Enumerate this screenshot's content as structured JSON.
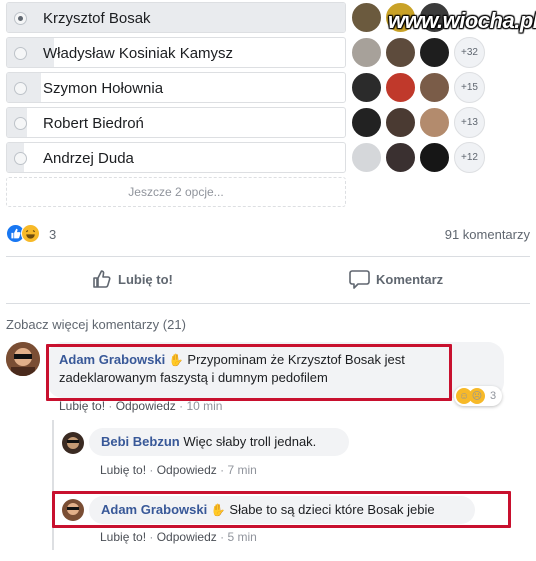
{
  "watermark": "www.wiocha.pl",
  "poll": {
    "options": [
      {
        "label": "Krzysztof Bosak",
        "selected": true,
        "fill_fraction": 1.0,
        "voters": [
          "avatar-a",
          "avatar-b",
          "avatar-c"
        ],
        "more": ""
      },
      {
        "label": "Władysław Kosiniak Kamysz",
        "selected": false,
        "fill_fraction": 0.14,
        "voters": [
          "avatar-d",
          "avatar-e",
          "avatar-f"
        ],
        "more": "+32"
      },
      {
        "label": "Szymon Hołownia",
        "selected": false,
        "fill_fraction": 0.1,
        "voters": [
          "avatar-g",
          "avatar-h",
          "avatar-i"
        ],
        "more": "+15"
      },
      {
        "label": "Robert Biedroń",
        "selected": false,
        "fill_fraction": 0.06,
        "voters": [
          "avatar-j",
          "avatar-k",
          "avatar-l"
        ],
        "more": "+13"
      },
      {
        "label": "Andrzej Duda",
        "selected": false,
        "fill_fraction": 0.05,
        "voters": [
          "avatar-m",
          "avatar-n",
          "avatar-o"
        ],
        "more": "+12"
      }
    ],
    "more_options": "Jeszcze 2 opcje..."
  },
  "reactions": {
    "count": "3",
    "icons": [
      "like-icon",
      "haha-icon"
    ],
    "comments_count": "91 komentarzy"
  },
  "actions": {
    "like": "Lubię to!",
    "comment": "Komentarz"
  },
  "comments_section": {
    "view_more": "Zobacz więcej komentarzy (21)",
    "comments": [
      {
        "author": "Adam Grabowski",
        "text": "Przypominam że Krzysztof Bosak jest zadeklarowanym faszystą i dumnym pedofilem",
        "like": "Lubię to!",
        "reply": "Odpowiedz",
        "time": "10 min",
        "reaction_count": "3"
      },
      {
        "author": "Bebi Bebzun",
        "text": "Więc słaby troll jednak.",
        "like": "Lubię to!",
        "reply": "Odpowiedz",
        "time": "7 min"
      },
      {
        "author": "Adam Grabowski",
        "text": "Słabe to są dzieci które Bosak jebie",
        "like": "Lubię to!",
        "reply": "Odpowiedz",
        "time": "5 min"
      }
    ]
  },
  "colors": {
    "link": "#385898",
    "highlight_box": "#c8102e",
    "like_blue": "#1877f2"
  }
}
